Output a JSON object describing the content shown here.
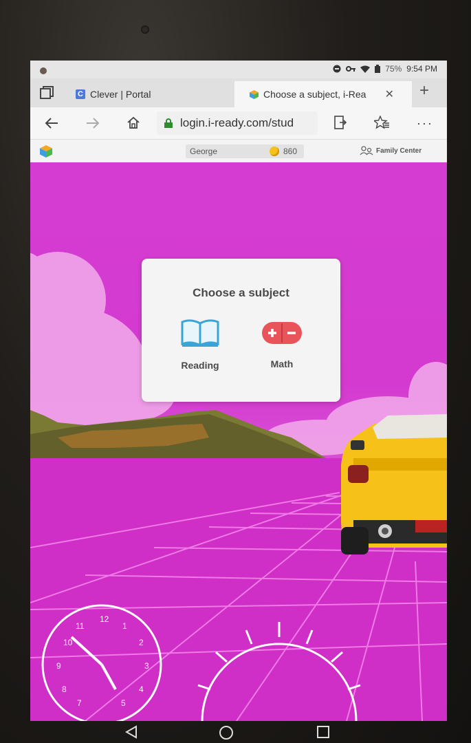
{
  "status_bar": {
    "battery": "75%",
    "time": "9:54 PM"
  },
  "tabs": [
    {
      "title": "Clever | Portal",
      "icon": "clever-icon",
      "active": false
    },
    {
      "title": "Choose a subject, i-Rea",
      "icon": "iready-cube-icon",
      "active": true
    }
  ],
  "address_bar": {
    "url": "login.i-ready.com/stud"
  },
  "iready_toolbar": {
    "student_name": "George",
    "coins": "860",
    "family_center": "Family Center"
  },
  "modal": {
    "title": "Choose a subject",
    "subjects": [
      {
        "label": "Reading",
        "icon": "book-icon"
      },
      {
        "label": "Math",
        "icon": "plus-minus-icon"
      }
    ]
  },
  "colors": {
    "scene_magenta": "#d631d0",
    "book_blue": "#3aa4d6",
    "math_red": "#e8545a",
    "car_yellow": "#f6c21a"
  }
}
